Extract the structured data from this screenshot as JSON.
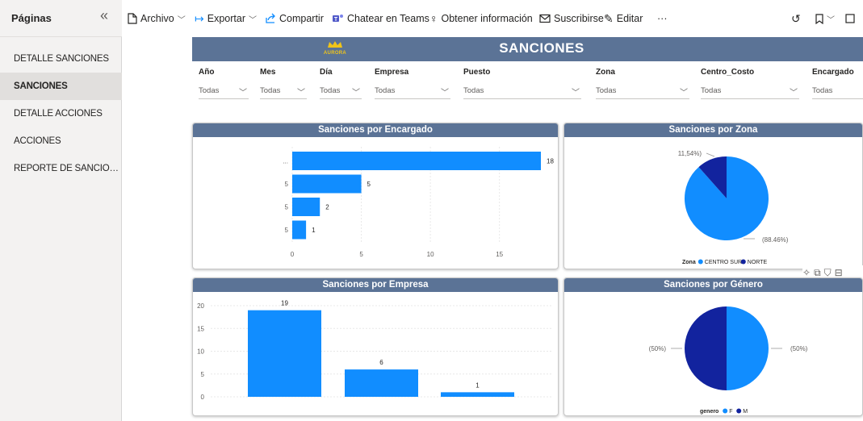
{
  "sidebar": {
    "title": "Páginas",
    "pages": [
      {
        "label": "DETALLE SANCIONES",
        "active": false
      },
      {
        "label": "SANCIONES",
        "active": true
      },
      {
        "label": "DETALLE ACCIONES",
        "active": false
      },
      {
        "label": "ACCIONES",
        "active": false
      },
      {
        "label": "REPORTE DE SANCIONE...",
        "active": false
      }
    ]
  },
  "toolbar": {
    "archivo": "Archivo",
    "exportar": "Exportar",
    "compartir": "Compartir",
    "teams": "Chatear en Teams",
    "obtener": "Obtener información",
    "suscribirse": "Suscribirse",
    "editar": "Editar",
    "more": "···"
  },
  "banner": {
    "title": "SANCIONES",
    "logo_text": "AURORA",
    "logo_color": "#f0c419"
  },
  "filters": [
    {
      "label": "Año",
      "value": "Todas"
    },
    {
      "label": "Mes",
      "value": "Todas"
    },
    {
      "label": "Día",
      "value": "Todas"
    },
    {
      "label": "Empresa",
      "value": "Todas"
    },
    {
      "label": "Puesto",
      "value": "Todas"
    },
    {
      "label": "Zona",
      "value": "Todas"
    },
    {
      "label": "Centro_Costo",
      "value": "Todas"
    },
    {
      "label": "Encargado",
      "value": "Todas"
    }
  ],
  "colors": {
    "header": "#5b7396",
    "bar": "#118dff",
    "dark": "#12239e"
  },
  "chart_data": [
    {
      "type": "bar",
      "orientation": "horizontal",
      "title": "Sanciones por Encargado",
      "categories": [
        "...",
        "5",
        "5",
        "5"
      ],
      "values": [
        18,
        5,
        2,
        1
      ],
      "xlim": [
        0,
        18
      ],
      "xticks": [
        "0",
        "5",
        "10",
        "15"
      ],
      "grid": true
    },
    {
      "type": "pie",
      "title": "Sanciones por Zona",
      "labels": [
        "CENTRO SUR",
        "NORTE"
      ],
      "values": [
        88.46,
        11.54
      ],
      "data_labels": [
        "(88.46%)",
        "11,54%)"
      ],
      "legend_title": "Zona",
      "legend_position": "bottom",
      "colors": [
        "#118dff",
        "#12239e"
      ]
    },
    {
      "type": "bar",
      "title": "Sanciones por Empresa",
      "categories": [
        "",
        "",
        ""
      ],
      "values": [
        19,
        6,
        1
      ],
      "ylim": [
        0,
        20
      ],
      "yticks": [
        "0",
        "5",
        "10",
        "15",
        "20"
      ],
      "grid": true
    },
    {
      "type": "pie",
      "title": "Sanciones por Género",
      "labels": [
        "F",
        "M"
      ],
      "values": [
        50,
        50
      ],
      "data_labels": [
        "(50%)",
        "(50%)"
      ],
      "legend_title": "genero",
      "legend_position": "bottom",
      "colors": [
        "#118dff",
        "#12239e"
      ]
    }
  ]
}
